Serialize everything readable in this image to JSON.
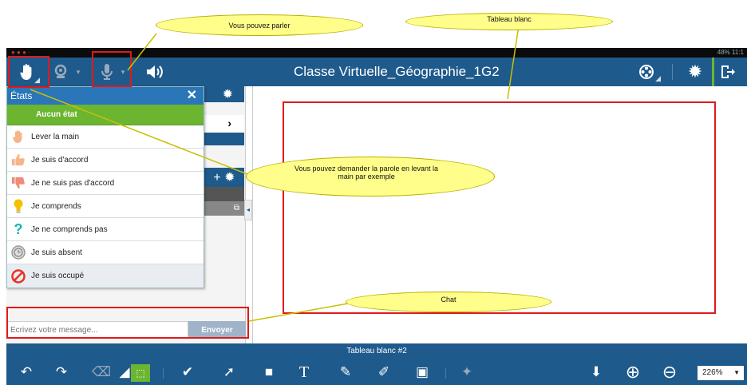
{
  "status_bar": {
    "right": "48% 11:1"
  },
  "topbar": {
    "title": "Classe Virtuelle_Géographie_1G2"
  },
  "states_panel": {
    "title": "États",
    "none_label": "Aucun état",
    "items": [
      {
        "label": "Lever la main",
        "icon": "raised-hand-icon"
      },
      {
        "label": "Je suis d'accord",
        "icon": "thumbs-up-icon"
      },
      {
        "label": "Je ne suis pas d'accord",
        "icon": "thumbs-down-icon"
      },
      {
        "label": "Je comprends",
        "icon": "lightbulb-icon"
      },
      {
        "label": "Je ne comprends pas",
        "icon": "question-icon"
      },
      {
        "label": "Je suis absent",
        "icon": "clock-icon"
      },
      {
        "label": "Je suis occupé",
        "icon": "forbidden-icon"
      }
    ]
  },
  "chat": {
    "placeholder": "Écrivez votre message...",
    "send_label": "Envoyer"
  },
  "whiteboard_tab": {
    "label": "Tableau blanc #2"
  },
  "toolbar": {
    "zoom": "226%"
  },
  "annotations": {
    "speak": "Vous pouvez parler",
    "whiteboard": "Tableau blanc",
    "raise_hand": "Vous pouvez demander la parole en levant la main par exemple",
    "chat": "Chat"
  },
  "colors": {
    "primary": "#1f5a8c",
    "header": "#2a76b8",
    "green": "#6bb531",
    "highlight": "#e01a1a",
    "bubble": "#fffe8a"
  }
}
